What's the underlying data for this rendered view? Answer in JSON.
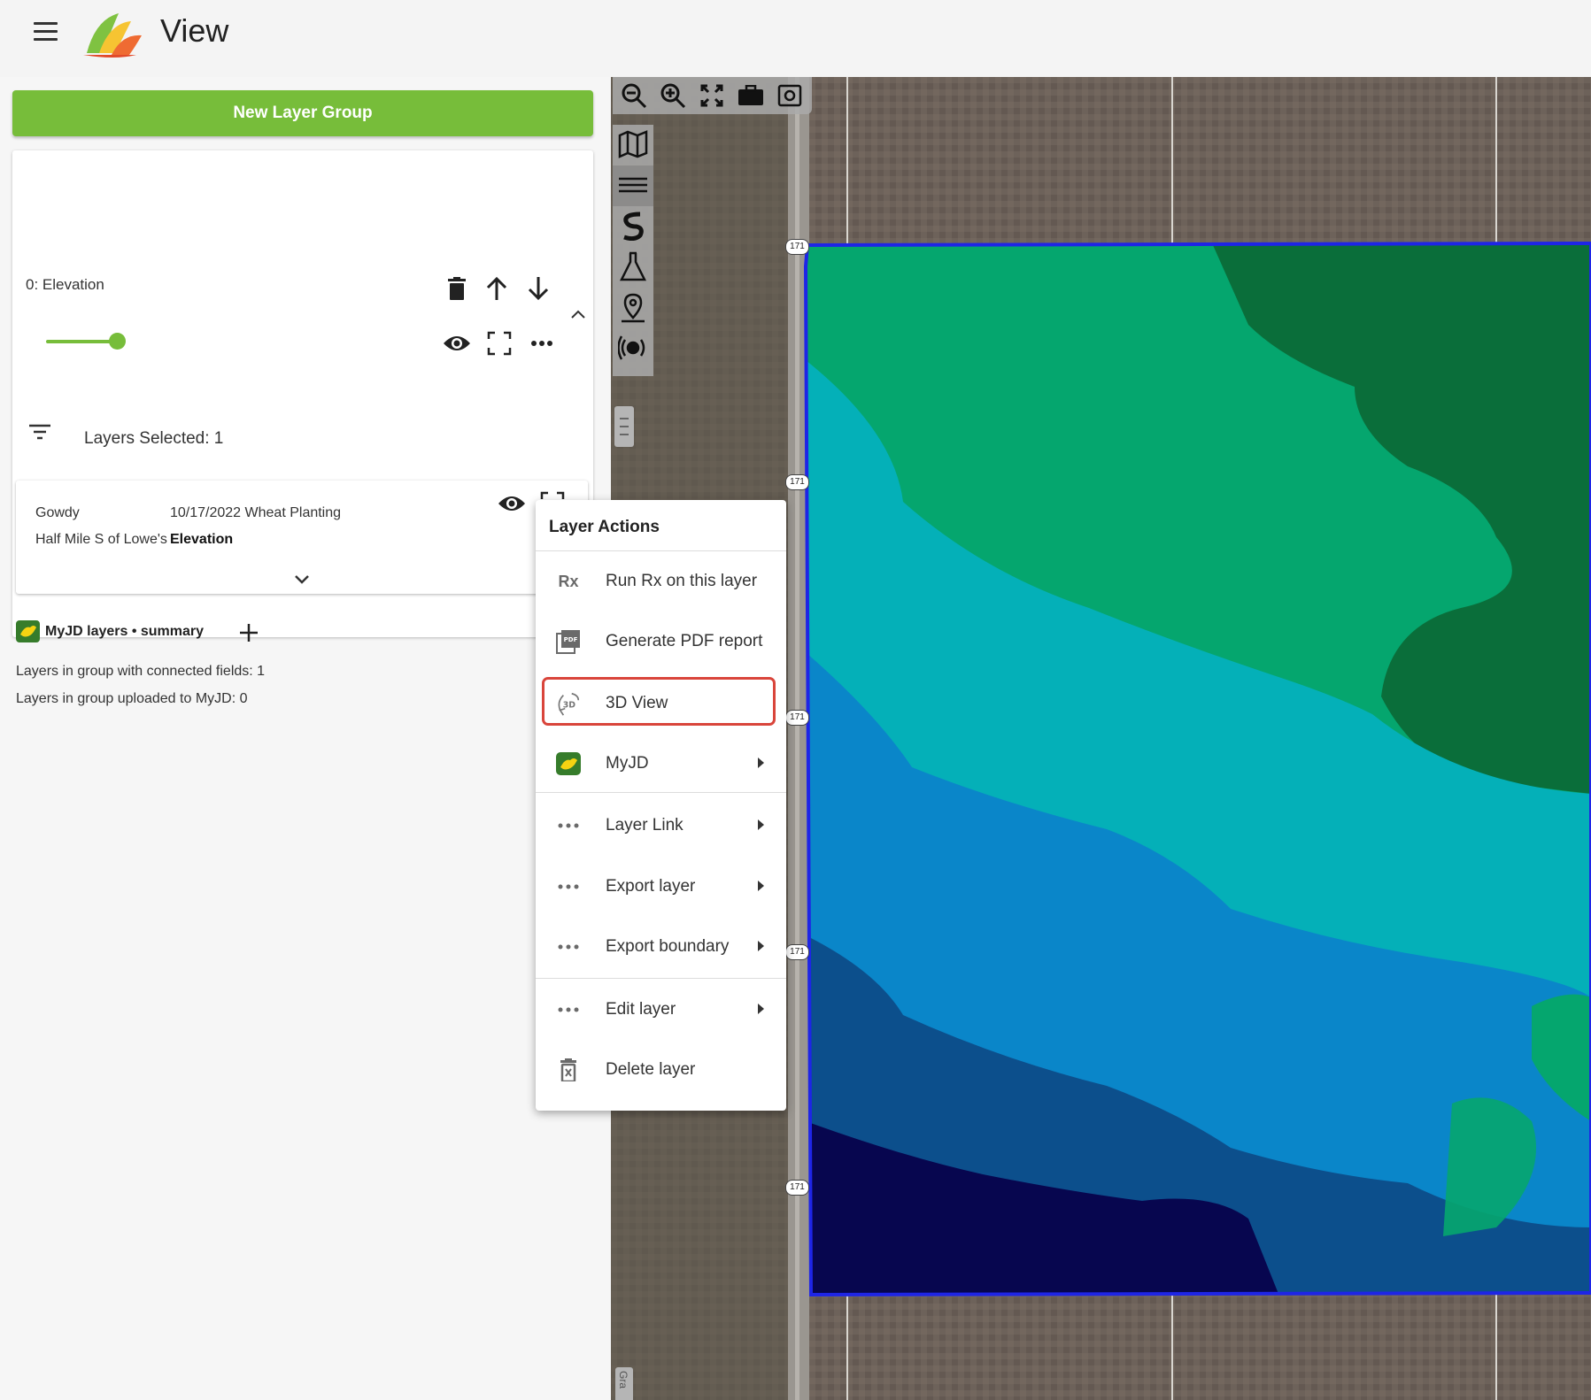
{
  "app": {
    "title": "View"
  },
  "sidebar": {
    "new_group_button": "New Layer Group",
    "group": {
      "name": "0: Elevation",
      "opacity": 0.8,
      "filter_label": "Layers Selected: 1"
    },
    "layer_card": {
      "farm": "Gowdy",
      "field": "Half Mile S of Lowe's",
      "operation": "10/17/2022 Wheat Planting",
      "layer_type": "Elevation"
    },
    "myjd": {
      "title": "MyJD layers • summary",
      "connected_fields": "Layers in group with connected fields: 1",
      "uploaded": "Layers in group uploaded to MyJD: 0"
    }
  },
  "map": {
    "toolbar_icons": [
      "zoom-out-icon",
      "zoom-in-icon",
      "fit-extent-icon",
      "briefcase-icon",
      "screenshot-icon"
    ],
    "side_tools": [
      "map-icon",
      "layers-icon",
      "soil-sampling-icon",
      "lab-flask-icon",
      "location-pin-icon",
      "sensor-icon"
    ],
    "road_shield": "171",
    "grab_tab": "Gra",
    "zone_colors": [
      "#0a6e3a",
      "#05a66e",
      "#04b0b8",
      "#0a86c9",
      "#0c4f8c",
      "#07064f"
    ]
  },
  "context_menu": {
    "title": "Layer Actions",
    "items": [
      {
        "label": "Run Rx on this layer",
        "icon_text": "Rx"
      },
      {
        "label": "Generate PDF report",
        "icon_text": "PDF"
      },
      {
        "label": "3D View",
        "icon_text": "3D",
        "highlighted": true
      },
      {
        "label": "MyJD"
      },
      {
        "label": "Layer Link"
      },
      {
        "label": "Export layer"
      },
      {
        "label": "Export boundary"
      },
      {
        "label": "Edit layer"
      },
      {
        "label": "Delete layer"
      }
    ]
  },
  "colors": {
    "accent": "#77bd3a",
    "highlight": "#d9453b",
    "boundary": "#1e25e6"
  }
}
